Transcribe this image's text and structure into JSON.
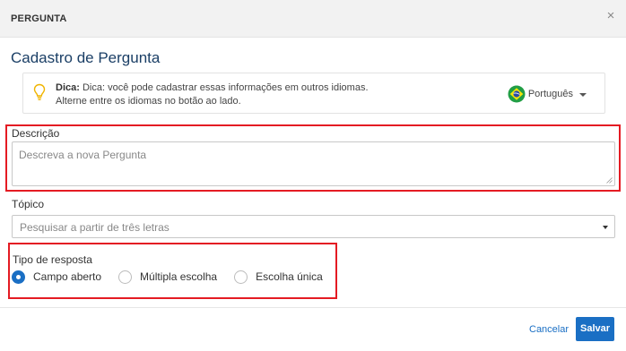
{
  "modal": {
    "header_title": "PERGUNTA",
    "close_symbol": "×",
    "page_title": "Cadastro de Pergunta"
  },
  "tip": {
    "bold_label": "Dica:",
    "line1": " Dica: você pode cadastrar essas informações em outros idiomas.",
    "line2": "Alterne entre os idiomas no botão ao lado.",
    "icon": "lightbulb-icon"
  },
  "language": {
    "selected": "Português",
    "flag": "brazil-flag-icon"
  },
  "fields": {
    "descricao": {
      "label": "Descrição",
      "placeholder": "Descreva a nova Pergunta"
    },
    "topico": {
      "label": "Tópico",
      "placeholder": "Pesquisar a partir de três letras"
    },
    "tipo_resposta": {
      "label": "Tipo de resposta",
      "options": [
        {
          "label": "Campo aberto",
          "checked": true
        },
        {
          "label": "Múltipla escolha",
          "checked": false
        },
        {
          "label": "Escolha única",
          "checked": false
        }
      ]
    }
  },
  "footer": {
    "cancel_label": "Cancelar",
    "save_label": "Salvar"
  },
  "colors": {
    "accent": "#1a6fc4",
    "title": "#1b3f66",
    "highlight": "#e41b23",
    "bulb": "#f0b400"
  }
}
